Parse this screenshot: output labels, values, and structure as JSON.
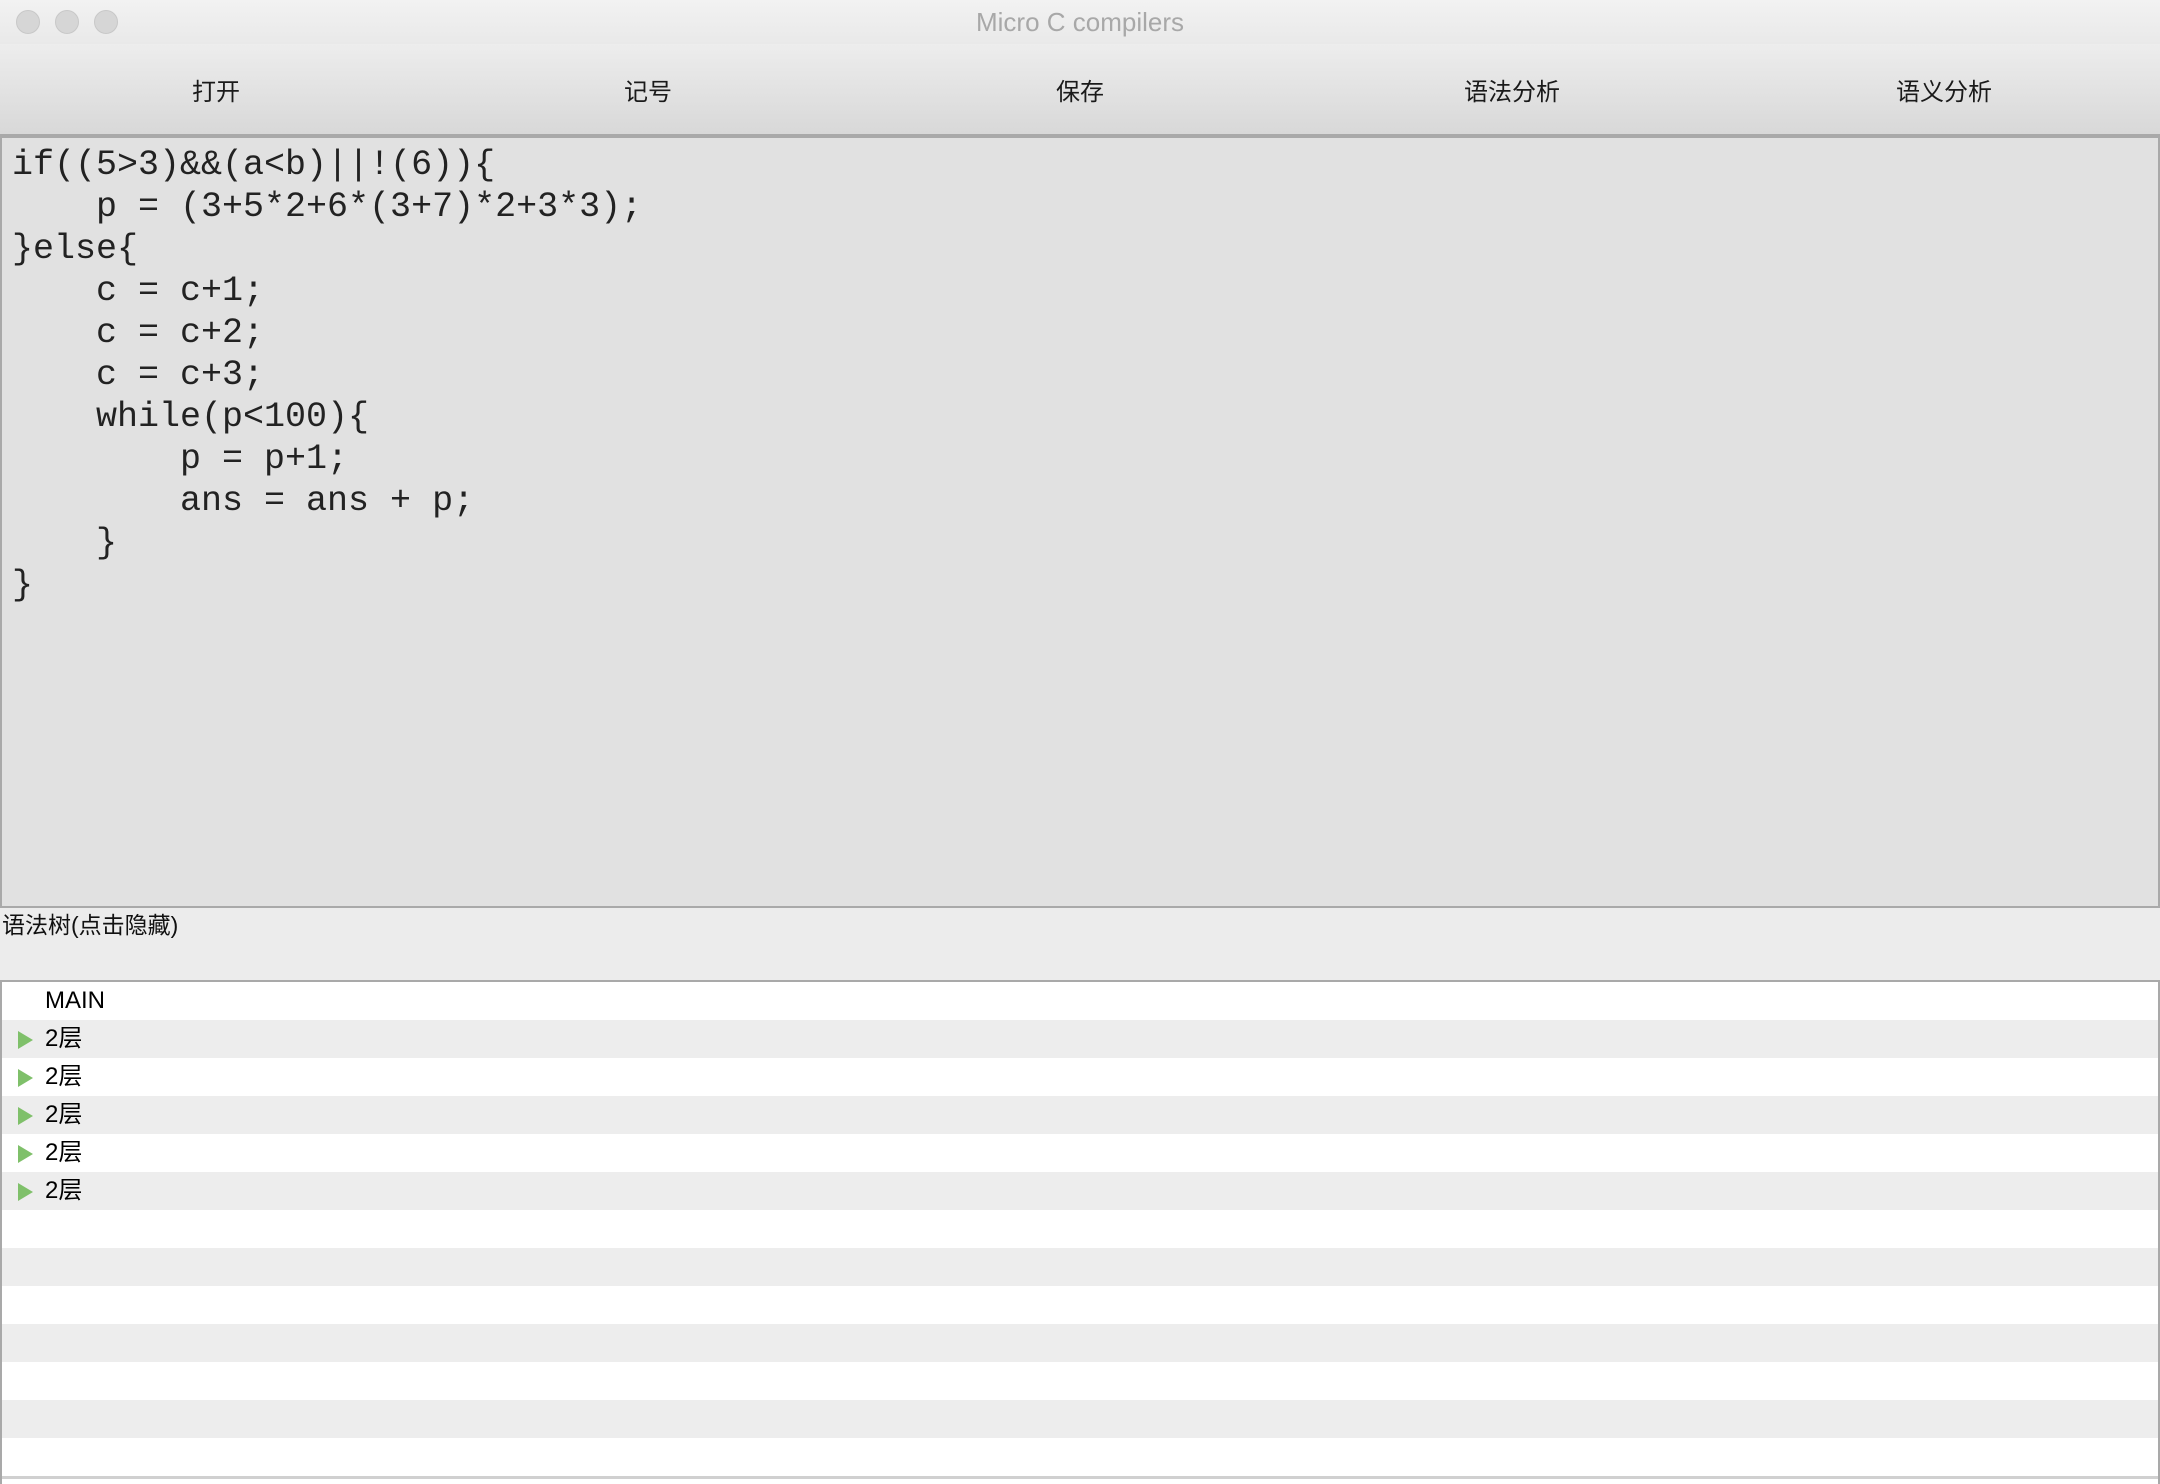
{
  "window": {
    "title": "Micro C compilers"
  },
  "toolbar": {
    "open_label": "打开",
    "token_label": "记号",
    "save_label": "保存",
    "syntax_label": "语法分析",
    "semantic_label": "语义分析"
  },
  "editor": {
    "code": "if((5>3)&&(a<b)||!(6)){\n    p = (3+5*2+6*(3+7)*2+3*3);\n}else{\n    c = c+1;\n    c = c+2;\n    c = c+3;\n    while(p<100){\n        p = p+1;\n        ans = ans + p;\n    }\n}"
  },
  "tree": {
    "label": "语法树(点击隐藏)",
    "root": "MAIN",
    "nodes": [
      {
        "label": "2层"
      },
      {
        "label": "2层"
      },
      {
        "label": "2层"
      },
      {
        "label": "2层"
      },
      {
        "label": "2层"
      }
    ]
  },
  "colors": {
    "expand_icon": "#7fc06a",
    "editor_bg": "#e1e1e1",
    "row_alt": "#ededed"
  },
  "icons": {
    "expand": "triangle-right-icon"
  }
}
